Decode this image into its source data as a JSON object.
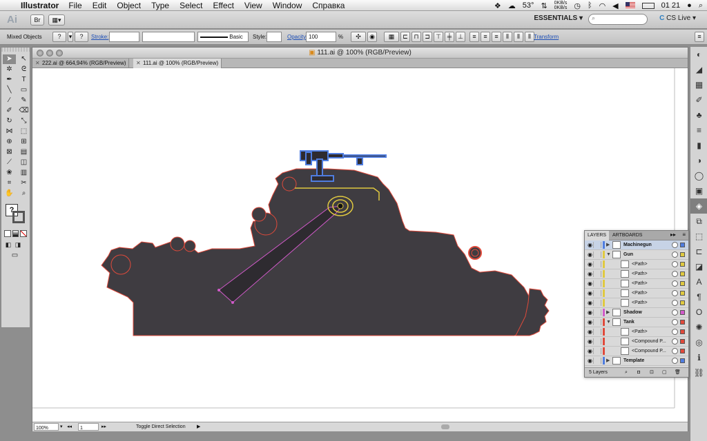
{
  "menubar": {
    "app_name": "Illustrator",
    "menus": [
      "File",
      "Edit",
      "Object",
      "Type",
      "Select",
      "Effect",
      "View",
      "Window",
      "Справка"
    ],
    "temperature": "53°",
    "net_up": "0KB/s",
    "net_down": "0KB/s",
    "clock": "01 21"
  },
  "appbar": {
    "logo": "Ai",
    "bridge": "Br",
    "workspace": "ESSENTIALS",
    "search_placeholder": "",
    "cs_live": "CS Live"
  },
  "controlbar": {
    "selection": "Mixed Objects",
    "fill_symbol": "?",
    "stroke_label": "Stroke:",
    "brush_style": "Basic",
    "style_label": "Style:",
    "opacity_label": "Opacity:",
    "opacity_value": "100",
    "opacity_unit": "%",
    "transform_label": "Transform"
  },
  "document": {
    "window_title": "111.ai @ 100% (RGB/Preview)",
    "tabs": [
      {
        "label": "222.ai @ 664,94% (RGB/Preview)"
      },
      {
        "label": "111.ai @ 100% (RGB/Preview)"
      }
    ],
    "zoom": "100%",
    "artboard_number": "1",
    "status_text": "Toggle Direct Selection"
  },
  "layers_panel": {
    "tab_layers": "LAYERS",
    "tab_artboards": "ARTBOARDS",
    "footer_count": "5 Layers",
    "rows": [
      {
        "name": "Machinegun",
        "level": 0,
        "color": "#4f7de0"
      },
      {
        "name": "Gun",
        "level": 0,
        "color": "#e0c940"
      },
      {
        "name": "<Path>",
        "level": 1,
        "color": "#e0c940"
      },
      {
        "name": "<Path>",
        "level": 1,
        "color": "#e0c940"
      },
      {
        "name": "<Path>",
        "level": 1,
        "color": "#e0c940"
      },
      {
        "name": "<Path>",
        "level": 1,
        "color": "#e0c940"
      },
      {
        "name": "<Path>",
        "level": 1,
        "color": "#e0c940"
      },
      {
        "name": "Shadow",
        "level": 0,
        "color": "#d15ac9"
      },
      {
        "name": "Tank",
        "level": 0,
        "color": "#e04a3b"
      },
      {
        "name": "<Path>",
        "level": 1,
        "color": "#e04a3b"
      },
      {
        "name": "<Compound P...",
        "level": 1,
        "color": "#e04a3b"
      },
      {
        "name": "<Compound P...",
        "level": 1,
        "color": "#e04a3b"
      },
      {
        "name": "Template",
        "level": 0,
        "color": "#4f7de0"
      }
    ]
  },
  "colors": {
    "tank_fill": "#3f3c41",
    "tank_outline": "#e04a3b",
    "machinegun_outline": "#4f7de0",
    "gun_outline": "#e0c940",
    "shadow_outline": "#d15ac9"
  }
}
